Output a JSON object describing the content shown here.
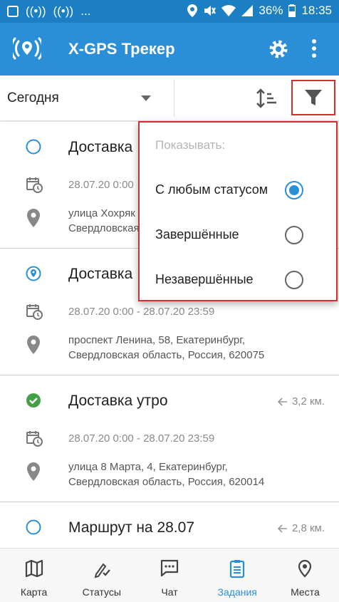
{
  "status_bar": {
    "left_icons": [
      "gallery-icon",
      "broadcast-icon",
      "broadcast-icon"
    ],
    "left_ellipsis": "...",
    "battery": "36%",
    "time": "18:35"
  },
  "app_bar": {
    "title": "X-GPS Трекер"
  },
  "toolbar": {
    "period": "Сегодня"
  },
  "filter_popup": {
    "header": "Показывать:",
    "options": [
      {
        "label": "С любым статусом",
        "selected": true
      },
      {
        "label": "Завершённые",
        "selected": false
      },
      {
        "label": "Незавершённые",
        "selected": false
      }
    ]
  },
  "tasks": [
    {
      "name": "Доставка",
      "status": "new",
      "distance": "",
      "time": "28.07.20 0:00",
      "address": "улица Хохряк\nСвердловская"
    },
    {
      "name": "Доставка",
      "status": "active",
      "distance": "",
      "time": "28.07.20 0:00 - 28.07.20 23:59",
      "address": "проспект Ленина, 58, Екатеринбург,\nСвердловская область, Россия, 620075"
    },
    {
      "name": "Доставка утро",
      "status": "done",
      "distance": "3,2 км.",
      "time": "28.07.20 0:00 - 28.07.20 23:59",
      "address": "улица 8 Марта, 4, Екатеринбург,\nСвердловская область, Россия, 620014"
    },
    {
      "name": "Маршрут на 28.07",
      "status": "new",
      "distance": "2,8 км.",
      "time": "",
      "address": ""
    }
  ],
  "bottom_nav": [
    {
      "label": "Карта",
      "icon": "map-icon",
      "active": false
    },
    {
      "label": "Статусы",
      "icon": "statuses-icon",
      "active": false
    },
    {
      "label": "Чат",
      "icon": "chat-icon",
      "active": false
    },
    {
      "label": "Задания",
      "icon": "tasks-icon",
      "active": true
    },
    {
      "label": "Места",
      "icon": "place-icon",
      "active": false
    }
  ],
  "colors": {
    "status_bar": "#1c7fc4",
    "app_bar": "#2a8fd6",
    "accent": "#2a8fd6",
    "done_green": "#43a047",
    "highlight_red": "#d32f2f"
  }
}
